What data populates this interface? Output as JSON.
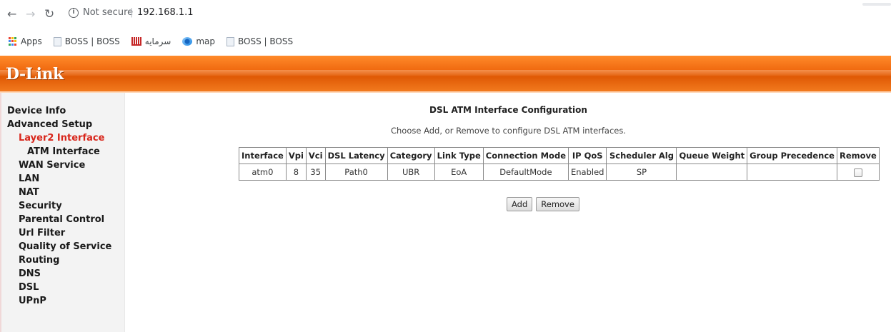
{
  "browser": {
    "security_label": "Not secure",
    "url": "192.168.1.1",
    "bookmarks": [
      {
        "label": "Apps"
      },
      {
        "label": "BOSS | BOSS"
      },
      {
        "label": "سرمایه"
      },
      {
        "label": "map"
      },
      {
        "label": "BOSS | BOSS"
      }
    ]
  },
  "brand": {
    "logo": "D-Link",
    "header_color": "#f06a10"
  },
  "sidebar": {
    "items": [
      {
        "label": "Device Info"
      },
      {
        "label": "Advanced Setup"
      },
      {
        "label": "Layer2 Interface"
      },
      {
        "label": "ATM Interface"
      },
      {
        "label": "WAN Service"
      },
      {
        "label": "LAN"
      },
      {
        "label": "NAT"
      },
      {
        "label": "Security"
      },
      {
        "label": "Parental Control"
      },
      {
        "label": "Url Filter"
      },
      {
        "label": "Quality of Service"
      },
      {
        "label": "Routing"
      },
      {
        "label": "DNS"
      },
      {
        "label": "DSL"
      },
      {
        "label": "UPnP"
      }
    ],
    "active_color": "#d8261b"
  },
  "main": {
    "title": "DSL ATM Interface Configuration",
    "subtitle": "Choose Add, or Remove to configure DSL ATM interfaces.",
    "table": {
      "headers": [
        "Interface",
        "Vpi",
        "Vci",
        "DSL Latency",
        "Category",
        "Link Type",
        "Connection Mode",
        "IP QoS",
        "Scheduler Alg",
        "Queue Weight",
        "Group Precedence",
        "Remove"
      ],
      "rows": [
        [
          "atm0",
          "8",
          "35",
          "Path0",
          "UBR",
          "EoA",
          "DefaultMode",
          "Enabled",
          "SP",
          "",
          "",
          ""
        ]
      ],
      "remove_checked": false
    },
    "buttons": {
      "add": "Add",
      "remove": "Remove"
    }
  }
}
